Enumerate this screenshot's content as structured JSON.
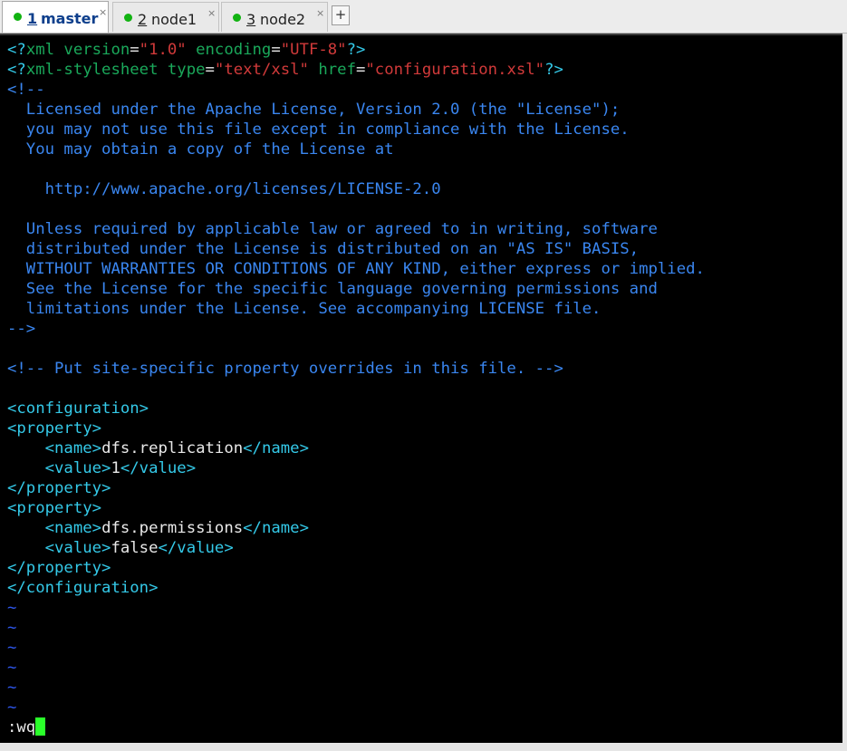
{
  "tabs": [
    {
      "num": "1",
      "title": "master",
      "close": "×",
      "active": true
    },
    {
      "num": "2",
      "title": "node1",
      "close": "×",
      "active": false
    },
    {
      "num": "3",
      "title": "node2",
      "close": "×",
      "active": false
    }
  ],
  "new_tab_label": "+",
  "colors": {
    "tab_status_dot": "#12b312",
    "terminal_bg": "#000000",
    "comment": "#3a86f0",
    "tag": "#34c9e8",
    "attribute": "#1aa85a",
    "string": "#d13a3a",
    "text": "#e8e8e8",
    "empty_line_tilde": "#2f58f0",
    "cursor": "#2aff2a"
  },
  "editor": {
    "line1": {
      "open": "<?",
      "tag": "xml",
      "attr1": " version",
      "eq1": "=",
      "val1": "\"1.0\"",
      "attr2": " encoding",
      "eq2": "=",
      "val2": "\"UTF-8\"",
      "close": "?>"
    },
    "line2": {
      "open": "<?",
      "tag": "xml-stylesheet",
      "attr1": " type",
      "eq1": "=",
      "val1": "\"text/xsl\"",
      "attr2": " href",
      "eq2": "=",
      "val2": "\"configuration.xsl\"",
      "close": "?>"
    },
    "comment_lines": [
      "<!--",
      "  Licensed under the Apache License, Version 2.0 (the \"License\");",
      "  you may not use this file except in compliance with the License.",
      "  You may obtain a copy of the License at",
      "",
      "    http://www.apache.org/licenses/LICENSE-2.0",
      "",
      "  Unless required by applicable law or agreed to in writing, software",
      "  distributed under the License is distributed on an \"AS IS\" BASIS,",
      "  WITHOUT WARRANTIES OR CONDITIONS OF ANY KIND, either express or implied.",
      "  See the License for the specific language governing permissions and",
      "  limitations under the License. See accompanying LICENSE file.",
      "-->",
      "",
      "<!-- Put site-specific property overrides in this file. -->"
    ],
    "config_open": "<configuration>",
    "config_close": "</configuration>",
    "property_open": "<property>",
    "property_close": "</property>",
    "name_open": "<name>",
    "name_close": "</name>",
    "value_open": "<value>",
    "value_close": "</value>",
    "properties": [
      {
        "name": "dfs.replication",
        "value": "1"
      },
      {
        "name": "dfs.permissions",
        "value": "false"
      }
    ],
    "tilde": "~",
    "command": ":wq"
  }
}
